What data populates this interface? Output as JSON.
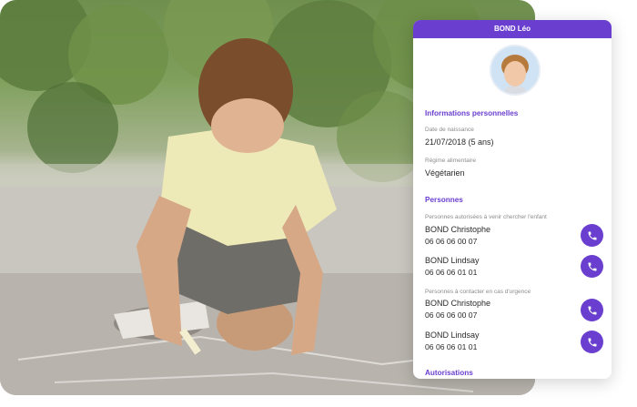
{
  "card": {
    "header_title": "BOND Léo",
    "sections": {
      "personal": {
        "title": "Informations personnelles",
        "birth_label": "Date de naissance",
        "birth_value": "21/07/2018 (5 ans)",
        "diet_label": "Régime alimentaire",
        "diet_value": "Végétarien"
      },
      "persons": {
        "title": "Personnes",
        "authorized_label": "Personnes autorisées à venir chercher l'enfant",
        "authorized": [
          {
            "name": "BOND Christophe",
            "phone": "06 06 06 00 07"
          },
          {
            "name": "BOND Lindsay",
            "phone": "06 06 06 01 01"
          }
        ],
        "emergency_label": "Personnes à contacter en cas d'urgence",
        "emergency": [
          {
            "name": "BOND Christophe",
            "phone": "06 06 06 00 07"
          },
          {
            "name": "BOND Lindsay",
            "phone": "06 06 06 01 01"
          }
        ]
      },
      "authorizations": {
        "title": "Autorisations"
      }
    },
    "colors": {
      "accent": "#6a3fd0"
    },
    "icons": {
      "call": "phone-icon"
    }
  }
}
